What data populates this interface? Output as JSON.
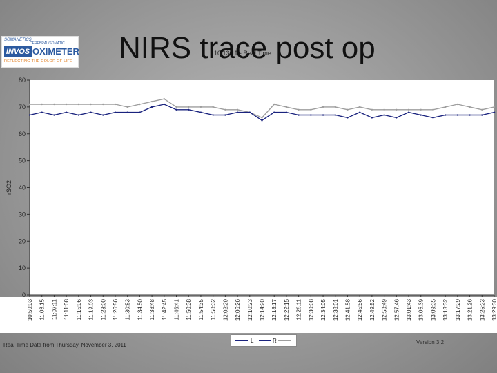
{
  "slide": {
    "title": "NIRS trace post op",
    "chart_caption": "10/13/11 - Real Time",
    "footer_left": "Real Time Data from Thursday, November 3, 2011",
    "footer_right": "Version 3.2"
  },
  "logo": {
    "brand": "SOMANETICS",
    "sub": "CEREBRAL/SOMATIC",
    "invos": "INVOS",
    "oximeter": "OXIMETER",
    "tagline": "REFLECTING THE COLOR OF LIFE"
  },
  "colors": {
    "L": "#1a237e",
    "R": "#9e9e9e",
    "axis": "#333333"
  },
  "chart_data": {
    "type": "line",
    "title": "10/13/11 - Real Time",
    "xlabel": "",
    "ylabel": "rSO2",
    "ylim": [
      0,
      80
    ],
    "yticks": [
      0,
      10,
      20,
      30,
      40,
      50,
      60,
      70,
      80
    ],
    "grid": false,
    "legend_position": "bottom",
    "categories": [
      "10:59:03",
      "11:03:15",
      "11:07:11",
      "11:11:08",
      "11:15:06",
      "11:19:03",
      "11:23:00",
      "11:26:56",
      "11:30:53",
      "11:34:50",
      "11:38:48",
      "11:42:45",
      "11:46:41",
      "11:50:38",
      "11:54:35",
      "11:58:32",
      "12:02:29",
      "12:06:26",
      "12:10:23",
      "12:14:20",
      "12:18:17",
      "12:22:15",
      "12:26:11",
      "12:30:08",
      "12:34:05",
      "12:38:01",
      "12:41:58",
      "12:45:56",
      "12:49:52",
      "12:53:49",
      "12:57:46",
      "13:01:43",
      "13:05:39",
      "13:09:35",
      "13:13:32",
      "13:17:29",
      "13:21:26",
      "13:25:23",
      "13:29:30"
    ],
    "series": [
      {
        "name": "L",
        "values": [
          67,
          68,
          67,
          68,
          67,
          68,
          67,
          68,
          68,
          68,
          70,
          71,
          69,
          69,
          68,
          67,
          67,
          68,
          68,
          65,
          68,
          68,
          67,
          67,
          67,
          67,
          66,
          68,
          66,
          67,
          66,
          68,
          67,
          66,
          67,
          67,
          67,
          67,
          68
        ]
      },
      {
        "name": "R",
        "values": [
          71,
          71,
          71,
          71,
          71,
          71,
          71,
          71,
          70,
          71,
          72,
          73,
          70,
          70,
          70,
          70,
          69,
          69,
          68,
          66,
          71,
          70,
          69,
          69,
          70,
          70,
          69,
          70,
          69,
          69,
          69,
          69,
          69,
          69,
          70,
          71,
          70,
          69,
          70
        ]
      }
    ]
  }
}
